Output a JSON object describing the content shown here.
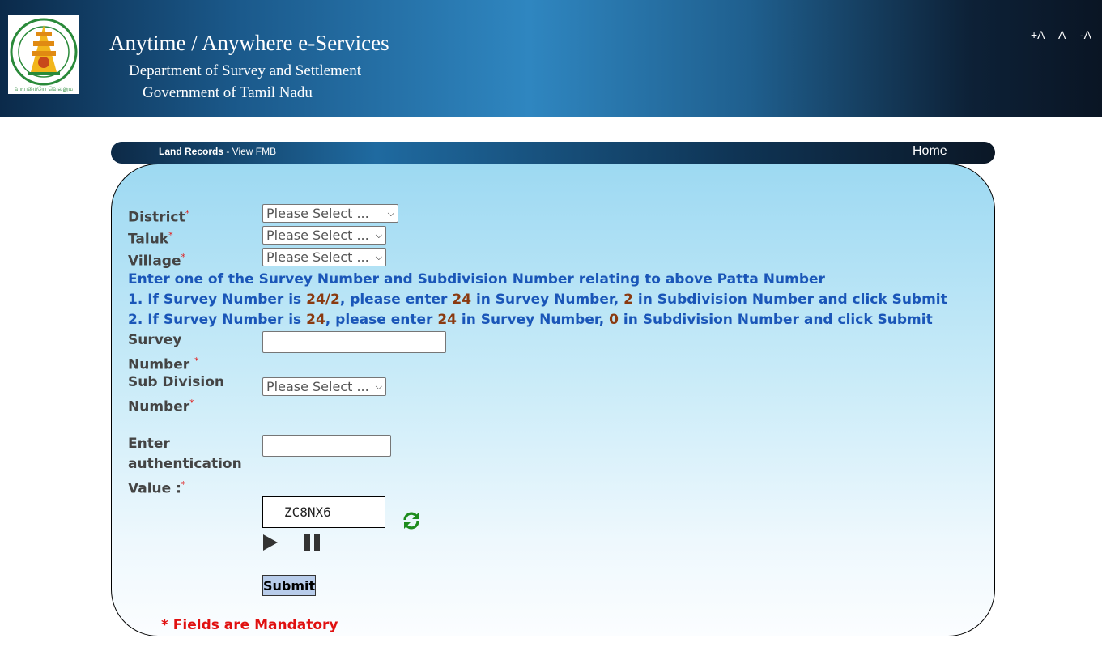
{
  "header": {
    "title": "Anytime / Anywhere e-Services",
    "department": "Department of Survey and Settlement",
    "government": "Government of Tamil Nadu",
    "emblem_text": "வாய்மையே வெல்லும்",
    "font_controls": [
      "+A",
      "A",
      "-A"
    ]
  },
  "nav": {
    "section": "Land Records",
    "page": " - View FMB",
    "home": "Home"
  },
  "form": {
    "district": {
      "label": "District",
      "value": "Please Select ..."
    },
    "taluk": {
      "label": "Taluk",
      "value": "Please Select ..."
    },
    "village": {
      "label": "Village",
      "value": "Please Select ..."
    },
    "required_mark": "*",
    "instructions": {
      "heading": "Enter one of the Survey Number and Subdivision Number relating to above Patta Number",
      "line1": {
        "p1": "1. If Survey Number is ",
        "v1": "24/2",
        "p2": ", please enter ",
        "v2": "24",
        "p3": " in Survey Number, ",
        "v3": "2",
        "p4": " in Subdivision Number and click Submit"
      },
      "line2": {
        "p1": "2. If Survey Number is ",
        "v1": "24",
        "p2": ", please enter ",
        "v2": "24",
        "p3": " in Survey Number, ",
        "v3": "0",
        "p4": " in Subdivision Number and click Submit"
      }
    },
    "survey_number": {
      "label_line1": "Survey",
      "label_line2": "Number ",
      "value": ""
    },
    "sub_division": {
      "label_line1": "Sub Division",
      "label_line2": "Number",
      "value": "Please Select ..."
    },
    "auth": {
      "label_line1": "Enter",
      "label_line2": "authentication",
      "label_line3": "Value :",
      "value": ""
    },
    "captcha": "ZC8NX6",
    "submit": "Submit",
    "mandatory_note": "* Fields are Mandatory"
  },
  "colors": {
    "info_blue": "#1a56b8",
    "highlight": "#8a3a10",
    "required_red": "#e02020",
    "refresh_green": "#1e8c1e"
  }
}
